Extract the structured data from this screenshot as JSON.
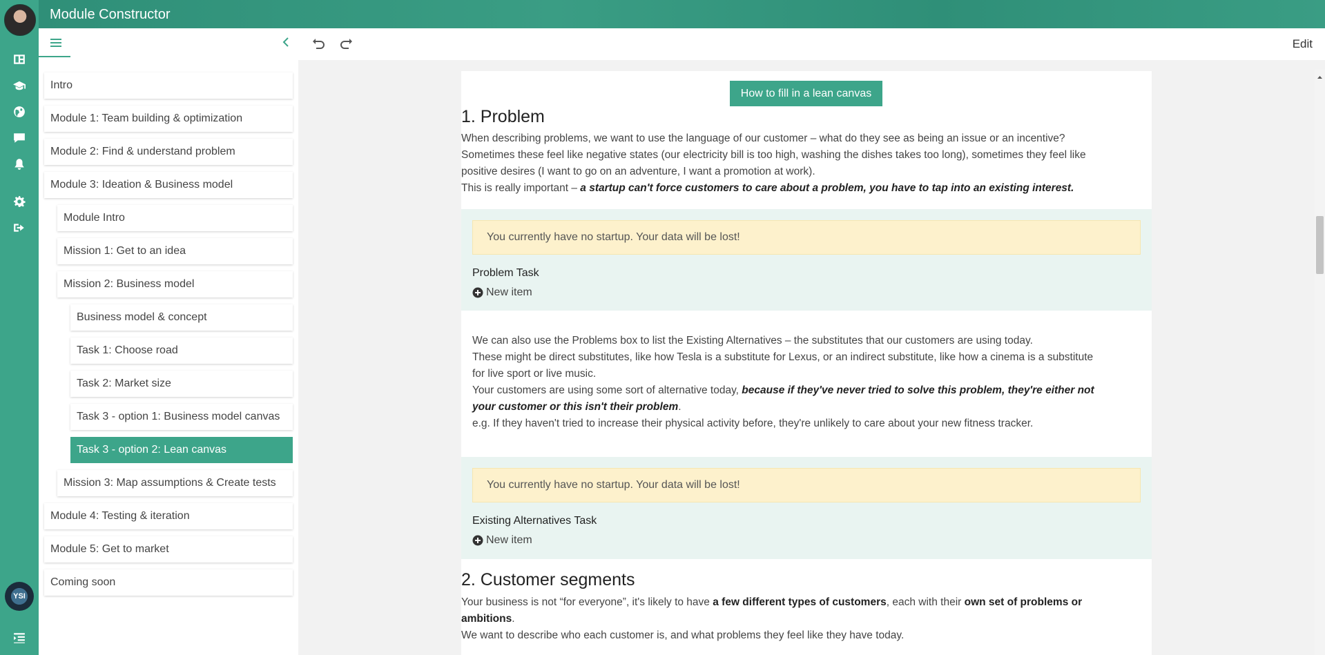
{
  "app": {
    "title": "Module Constructor"
  },
  "rail": {
    "icons": [
      "avatar",
      "dashboard-icon",
      "graduation-cap-icon",
      "globe-icon",
      "chat-icon",
      "bell-icon",
      "gear-icon",
      "logout-icon",
      "org-logo",
      "list-indent-icon"
    ],
    "logo_text": "YSI"
  },
  "toolbar": {
    "edit_label": "Edit"
  },
  "sidebar": {
    "items": [
      {
        "label": "Intro",
        "level": 0,
        "active": false
      },
      {
        "label": "Module 1: Team building & optimization",
        "level": 0,
        "active": false
      },
      {
        "label": "Module 2: Find & understand problem",
        "level": 0,
        "active": false
      },
      {
        "label": "Module 3: Ideation & Business model",
        "level": 0,
        "active": false
      },
      {
        "label": "Module Intro",
        "level": 1,
        "active": false
      },
      {
        "label": "Mission 1: Get to an idea",
        "level": 1,
        "active": false
      },
      {
        "label": "Mission 2: Business model",
        "level": 1,
        "active": false
      },
      {
        "label": "Business model & concept",
        "level": 2,
        "active": false
      },
      {
        "label": "Task 1: Choose road",
        "level": 2,
        "active": false
      },
      {
        "label": "Task 2: Market size",
        "level": 2,
        "active": false
      },
      {
        "label": "Task 3 - option 1: Business model canvas",
        "level": 2,
        "active": false
      },
      {
        "label": "Task 3 - option 2: Lean canvas",
        "level": 2,
        "active": true
      },
      {
        "label": "Mission 3: Map assumptions & Create tests",
        "level": 1,
        "active": false
      },
      {
        "label": "Module 4: Testing & iteration",
        "level": 0,
        "active": false
      },
      {
        "label": "Module 5: Get to market",
        "level": 0,
        "active": false
      },
      {
        "label": "Coming soon",
        "level": 0,
        "active": false
      }
    ]
  },
  "content": {
    "fill_button": "How to fill in a lean canvas",
    "problem": {
      "heading": "1. Problem",
      "p1": "When describing problems, we want to use the language of our customer – what do they see as being an issue or an incentive?",
      "p2": "Sometimes these feel like negative states (our electricity bill is too high, washing the dishes takes too long), sometimes they feel like",
      "p3": "positive desires (I want to go on an adventure, I want a promotion at work).",
      "p4_lead": "This is really important – ",
      "p4_em": "a startup can't force customers to care about a problem, you have to tap into an existing interest."
    },
    "warning": "You currently have no startup. Your data will be lost!",
    "problem_task": {
      "title": "Problem Task",
      "new_item": "New item"
    },
    "alternatives": {
      "l1": "We can also use the Problems box to list the Existing Alternatives – the substitutes that our customers are using today.",
      "l2": "These might be direct substitutes, like how Tesla is a substitute for Lexus, or an indirect substitute, like how a cinema is a substitute",
      "l3": "for live sport or live music.",
      "l4_lead": "Your customers are using some sort of alternative today, ",
      "l4_em": "because if they've never tried to solve this problem, they're either not",
      "l5_em": "your customer or this isn't their problem",
      "l5_tail": ".",
      "l6": "e.g. If they haven't tried to increase their physical activity before, they're unlikely to care about your new fitness tracker."
    },
    "alternatives_task": {
      "title": "Existing Alternatives Task",
      "new_item": "New item"
    },
    "segments": {
      "heading": "2. Customer segments",
      "l1_a": "Your business is not “for everyone”, it's likely to have ",
      "l1_b": "a few different types of customers",
      "l1_c": ", each with their ",
      "l1_d": "own set of problems or",
      "l2_b": "ambitions",
      "l2_c": ".",
      "l3": "We want to describe who each customer is, and what problems they feel like they have today."
    }
  }
}
